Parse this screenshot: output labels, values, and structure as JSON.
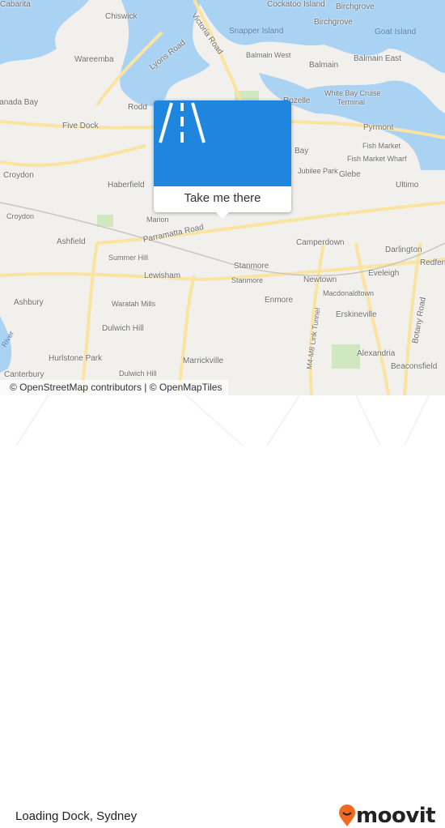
{
  "map": {
    "labels": [
      "Cabarita",
      "Chiswick",
      "Victoria Road",
      "Cockatoo Island",
      "Birchgrove",
      "Snapper Island",
      "Birchgrove",
      "Goat Island",
      "Lyons Road",
      "Wareemba",
      "Balmain West",
      "Balmain",
      "Balmain East",
      "Canada Bay",
      "Rodd",
      "Rozelle",
      "White Bay Cruise",
      "Terminal",
      "Pyrmont",
      "Five Dock",
      "Fish Market",
      "Fish Market Wharf",
      "Glebe",
      "Jubilee Park",
      "Croydon",
      "Haberfield",
      "Ultimo",
      "Croydon",
      "Marion",
      "Parramatta Road",
      "Ashfield",
      "Camperdown",
      "Darlington",
      "Redfern",
      "Summer Hill",
      "Stanmore",
      "Lewisham",
      "Stanmore",
      "Eveleigh",
      "Newtown",
      "Macdonaldtown",
      "Ashbury",
      "Waratah Mills",
      "Enmore",
      "Erskineville",
      "Botany Road",
      "M4-M8 Link Tunnel",
      "Dulwich Hill",
      "Hurlstone Park",
      "Marrickville",
      "Alexandria",
      "Beaconsfield",
      "Canterbury",
      "Dulwich Hill",
      "Bay",
      "River"
    ],
    "attribution": "© OpenStreetMap contributors | © OpenMapTiles",
    "colors": {
      "land": "#f1f0ed",
      "water": "#a9d2f3",
      "road": "#fbe7a3",
      "park": "#cfe8c0"
    }
  },
  "popup": {
    "icon": "road-icon",
    "action_label": "Take me there",
    "color": "#1e86de"
  },
  "footer": {
    "title": "Loading Dock, Sydney",
    "brand": "moovit",
    "brand_color": "#f26a20"
  }
}
